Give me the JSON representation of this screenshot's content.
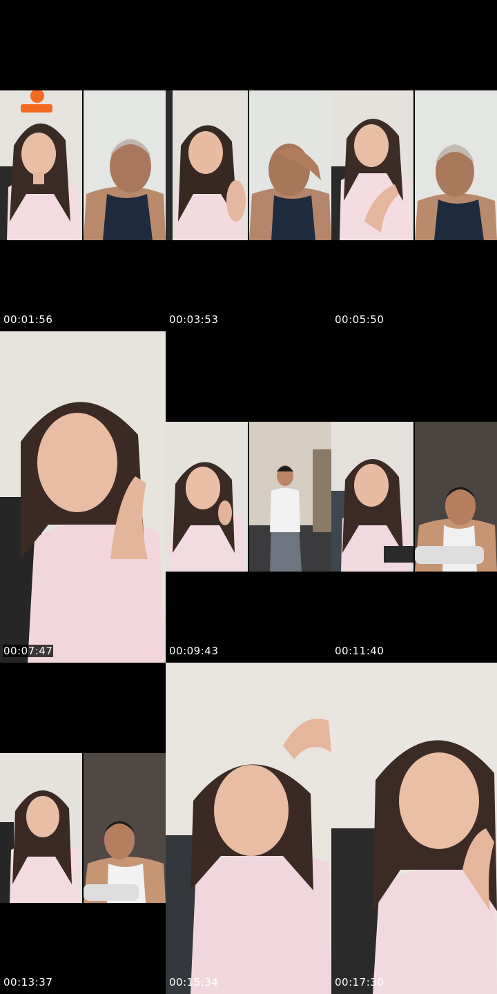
{
  "thumbnails": [
    {
      "timestamp": "00:01:56"
    },
    {
      "timestamp": "00:03:53"
    },
    {
      "timestamp": "00:05:50"
    },
    {
      "timestamp": "00:07:47"
    },
    {
      "timestamp": "00:09:43"
    },
    {
      "timestamp": "00:11:40"
    },
    {
      "timestamp": "00:13:37"
    },
    {
      "timestamp": "00:15:34"
    },
    {
      "timestamp": "00:17:30"
    }
  ],
  "colors": {
    "background": "#000000",
    "timestamp_text": "#ffffff",
    "shirt_pink": "#f2d6dc",
    "skin": "#d9a98c"
  },
  "icons": [
    "live-badge-icon"
  ]
}
